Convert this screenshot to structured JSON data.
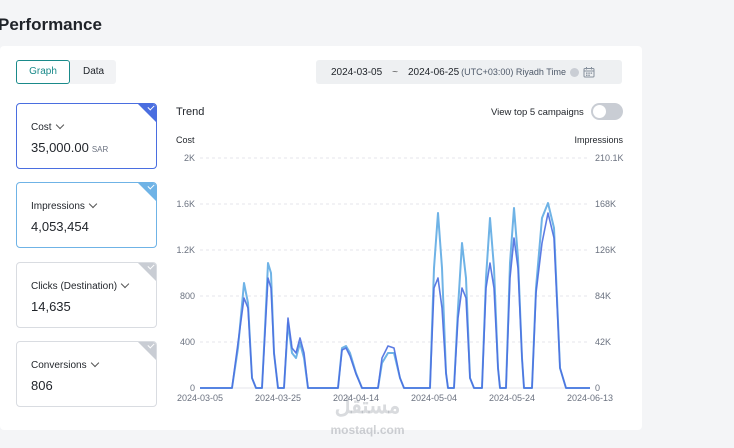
{
  "page": {
    "title": "Performance"
  },
  "view_tabs": [
    {
      "label": "Graph",
      "active": true
    },
    {
      "label": "Data",
      "active": false
    }
  ],
  "date_range": {
    "start": "2024-03-05",
    "separator": "~",
    "end": "2024-06-25",
    "timezone": "(UTC+03:00) Riyadh Time"
  },
  "metrics": [
    {
      "label": "Cost",
      "value": "35,000.00",
      "unit": "SAR",
      "selected": true,
      "color": "#4a6ee0"
    },
    {
      "label": "Impressions",
      "value": "4,053,454",
      "unit": "",
      "selected": true,
      "color": "#6fb3e6"
    },
    {
      "label": "Clicks (Destination)",
      "value": "14,635",
      "unit": "",
      "selected": false,
      "color": "#c9cdd4"
    },
    {
      "label": "Conversions",
      "value": "806",
      "unit": "",
      "selected": false,
      "color": "#c9cdd4"
    }
  ],
  "trend": {
    "title": "Trend",
    "toggle_label": "View top 5 campaigns",
    "toggle_on": false
  },
  "watermark": {
    "arabic": "مستقل",
    "latin": "mostaql.com"
  },
  "chart_data": {
    "type": "line",
    "title": "Trend",
    "left_axis": {
      "label": "Cost",
      "ticks": [
        "0",
        "400",
        "800",
        "1.2K",
        "1.6K",
        "2K"
      ],
      "ylim": [
        0,
        2000
      ]
    },
    "right_axis": {
      "label": "Impressions",
      "ticks": [
        "0",
        "42K",
        "84K",
        "126K",
        "168K",
        "210.1K"
      ],
      "ylim": [
        0,
        210100
      ]
    },
    "x_ticks": [
      "2024-03-05",
      "2024-03-25",
      "2024-04-14",
      "2024-05-04",
      "2024-05-24",
      "2024-06-13"
    ],
    "grid": true,
    "series": [
      {
        "name": "Cost",
        "axis": "left",
        "color": "#4a6ee0",
        "points": [
          [
            0,
            0
          ],
          [
            1,
            0
          ],
          [
            2,
            0
          ],
          [
            3,
            0
          ],
          [
            4,
            0
          ],
          [
            5,
            0
          ],
          [
            6,
            0
          ],
          [
            7,
            0
          ],
          [
            8,
            0
          ],
          [
            9,
            0
          ],
          [
            10,
            0
          ],
          [
            11,
            0
          ],
          [
            12,
            0
          ],
          [
            13,
            0
          ],
          [
            14,
            0
          ],
          [
            15,
            0
          ],
          [
            16,
            0
          ],
          [
            17,
            0
          ],
          [
            18,
            0
          ],
          [
            19,
            0
          ],
          [
            20,
            0
          ],
          [
            21,
            0
          ],
          [
            22,
            0
          ],
          [
            23,
            0
          ],
          [
            24,
            0
          ],
          [
            25,
            0
          ],
          [
            26,
            0
          ],
          [
            27,
            0
          ],
          [
            28,
            0
          ],
          [
            29,
            0
          ],
          [
            30,
            0
          ],
          [
            31,
            0
          ],
          [
            32,
            0
          ],
          [
            33,
            0
          ],
          [
            34,
            0
          ],
          [
            35,
            0
          ],
          [
            36,
            0
          ],
          [
            37,
            0
          ],
          [
            38,
            0
          ],
          [
            39,
            0
          ],
          [
            40,
            0
          ],
          [
            41,
            0
          ],
          [
            42,
            0
          ],
          [
            43,
            0
          ],
          [
            44,
            0
          ],
          [
            45,
            0
          ],
          [
            46,
            0
          ],
          [
            47,
            0
          ],
          [
            48,
            0
          ],
          [
            49,
            0
          ],
          [
            50,
            0
          ],
          [
            51,
            0
          ],
          [
            52,
            0
          ],
          [
            53,
            0
          ],
          [
            54,
            0
          ],
          [
            55,
            0
          ],
          [
            56,
            0
          ],
          [
            57,
            0
          ],
          [
            58,
            0
          ],
          [
            59,
            0
          ],
          [
            60,
            0
          ],
          [
            61,
            0
          ],
          [
            62,
            0
          ],
          [
            63,
            0
          ],
          [
            64,
            0
          ],
          [
            65,
            0
          ],
          [
            66,
            0
          ],
          [
            67,
            0
          ],
          [
            68,
            0
          ],
          [
            69,
            0
          ],
          [
            70,
            0
          ],
          [
            71,
            0
          ],
          [
            72,
            0
          ],
          [
            73,
            0
          ],
          [
            74,
            0
          ],
          [
            75,
            0
          ],
          [
            76,
            0
          ],
          [
            77,
            0
          ],
          [
            78,
            0
          ],
          [
            79,
            0
          ],
          [
            80,
            0
          ],
          [
            81,
            0
          ],
          [
            82,
            0
          ],
          [
            83,
            0
          ],
          [
            84,
            0
          ],
          [
            85,
            0
          ],
          [
            86,
            0
          ],
          [
            87,
            0
          ],
          [
            88,
            0
          ],
          [
            89,
            0
          ],
          [
            90,
            0
          ],
          [
            91,
            0
          ],
          [
            92,
            0
          ],
          [
            93,
            0
          ],
          [
            94,
            0
          ],
          [
            95,
            0
          ],
          [
            96,
            0
          ],
          [
            97,
            0
          ],
          [
            98,
            0
          ],
          [
            99,
            0
          ],
          [
            100,
            0
          ],
          [
            101,
            0
          ],
          [
            102,
            0
          ],
          [
            103,
            0
          ],
          [
            104,
            0
          ],
          [
            105,
            0
          ],
          [
            106,
            0
          ],
          [
            107,
            0
          ],
          [
            108,
            0
          ],
          [
            109,
            0
          ],
          [
            110,
            0
          ]
        ]
      }
    ]
  }
}
